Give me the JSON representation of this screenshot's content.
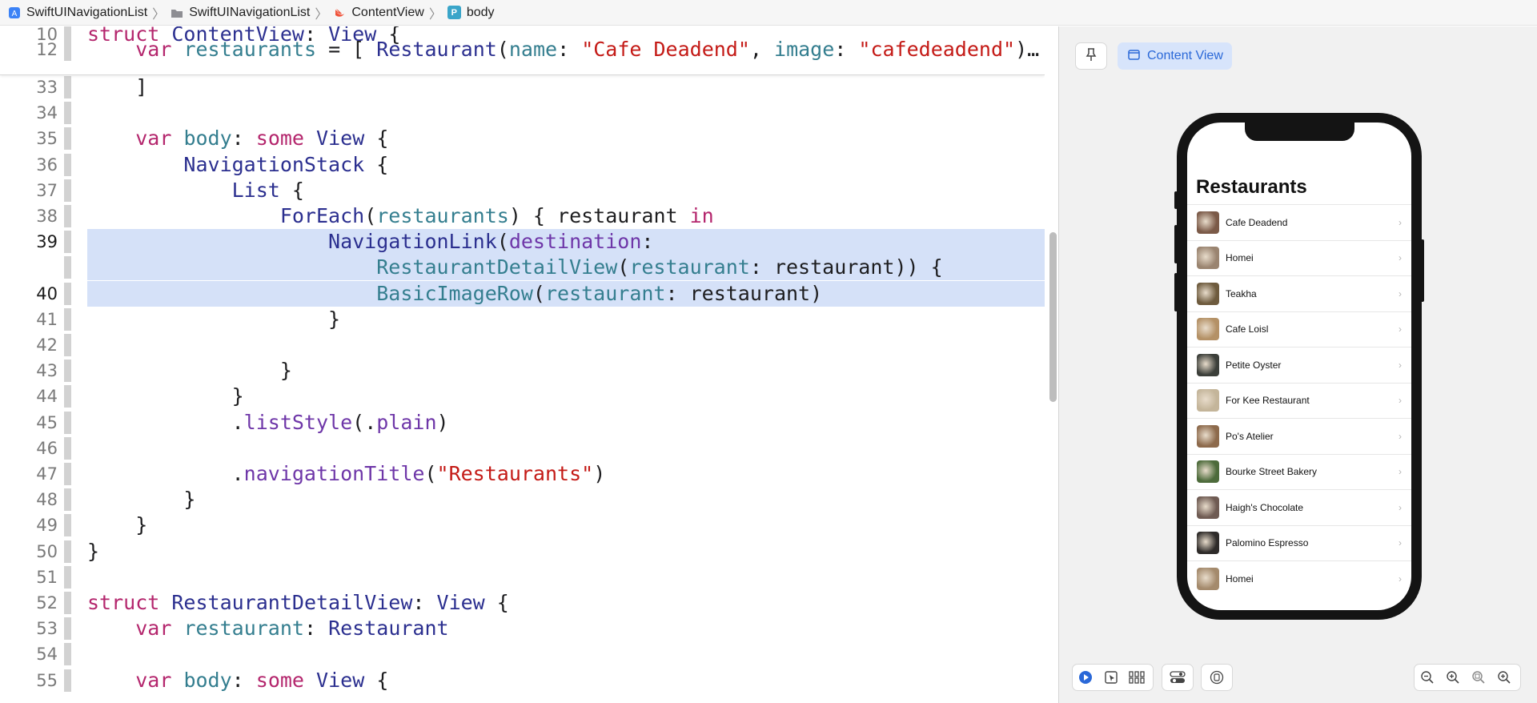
{
  "breadcrumb": {
    "project": "SwiftUINavigationList",
    "folder": "SwiftUINavigationList",
    "file": "ContentView",
    "symbol_badge": "P",
    "symbol": "body"
  },
  "sticky_lines": [
    {
      "number": "10",
      "tokens": [
        {
          "t": "struct",
          "c": "kw"
        },
        {
          "t": " ",
          "c": "tx"
        },
        {
          "t": "ContentView",
          "c": "ty"
        },
        {
          "t": ": ",
          "c": "tx"
        },
        {
          "t": "View",
          "c": "ty"
        },
        {
          "t": " {",
          "c": "tx"
        }
      ]
    },
    {
      "number": "12",
      "tokens": [
        {
          "t": "    ",
          "c": "tx"
        },
        {
          "t": "var",
          "c": "kw"
        },
        {
          "t": " ",
          "c": "tx"
        },
        {
          "t": "restaurants",
          "c": "pr"
        },
        {
          "t": " = [ ",
          "c": "tx"
        },
        {
          "t": "Restaurant",
          "c": "ty"
        },
        {
          "t": "(",
          "c": "tx"
        },
        {
          "t": "name",
          "c": "pr"
        },
        {
          "t": ": ",
          "c": "tx"
        },
        {
          "t": "\"Cafe Deadend\"",
          "c": "st"
        },
        {
          "t": ", ",
          "c": "tx"
        },
        {
          "t": "image",
          "c": "pr"
        },
        {
          "t": ": ",
          "c": "tx"
        },
        {
          "t": "\"cafedeadend\"",
          "c": "st"
        },
        {
          "t": ")…",
          "c": "tx"
        }
      ]
    }
  ],
  "lines": [
    {
      "number": "33",
      "tokens": [
        {
          "t": "    ]",
          "c": "tx"
        }
      ]
    },
    {
      "number": "34",
      "tokens": []
    },
    {
      "number": "35",
      "tokens": [
        {
          "t": "    ",
          "c": "tx"
        },
        {
          "t": "var",
          "c": "kw"
        },
        {
          "t": " ",
          "c": "tx"
        },
        {
          "t": "body",
          "c": "pr"
        },
        {
          "t": ": ",
          "c": "tx"
        },
        {
          "t": "some",
          "c": "kw"
        },
        {
          "t": " ",
          "c": "tx"
        },
        {
          "t": "View",
          "c": "ty"
        },
        {
          "t": " {",
          "c": "tx"
        }
      ]
    },
    {
      "number": "36",
      "tokens": [
        {
          "t": "        ",
          "c": "tx"
        },
        {
          "t": "NavigationStack",
          "c": "ty"
        },
        {
          "t": " {",
          "c": "tx"
        }
      ]
    },
    {
      "number": "37",
      "tokens": [
        {
          "t": "            ",
          "c": "tx"
        },
        {
          "t": "List",
          "c": "ty"
        },
        {
          "t": " {",
          "c": "tx"
        }
      ]
    },
    {
      "number": "38",
      "tokens": [
        {
          "t": "                ",
          "c": "tx"
        },
        {
          "t": "ForEach",
          "c": "ty"
        },
        {
          "t": "(",
          "c": "tx"
        },
        {
          "t": "restaurants",
          "c": "pr"
        },
        {
          "t": ") { restaurant ",
          "c": "tx"
        },
        {
          "t": "in",
          "c": "kw"
        }
      ]
    },
    {
      "number": "39",
      "highlight": true,
      "tokens": [
        {
          "t": "                    ",
          "c": "tx"
        },
        {
          "t": "NavigationLink",
          "c": "ty"
        },
        {
          "t": "(",
          "c": "tx"
        },
        {
          "t": "destination",
          "c": "fn"
        },
        {
          "t": ":",
          "c": "tx"
        }
      ]
    },
    {
      "number": "",
      "highlight": true,
      "tokens": [
        {
          "t": "                        ",
          "c": "tx"
        },
        {
          "t": "RestaurantDetailView",
          "c": "pr"
        },
        {
          "t": "(",
          "c": "tx"
        },
        {
          "t": "restaurant",
          "c": "pr"
        },
        {
          "t": ": restaurant)) {",
          "c": "tx"
        }
      ]
    },
    {
      "number": "40",
      "highlight": true,
      "tokens": [
        {
          "t": "                        ",
          "c": "tx"
        },
        {
          "t": "BasicImageRow",
          "c": "pr"
        },
        {
          "t": "(",
          "c": "tx"
        },
        {
          "t": "restaurant",
          "c": "pr"
        },
        {
          "t": ": restaurant)",
          "c": "tx"
        }
      ]
    },
    {
      "number": "41",
      "tokens": [
        {
          "t": "                    }",
          "c": "tx"
        }
      ]
    },
    {
      "number": "42",
      "tokens": []
    },
    {
      "number": "43",
      "tokens": [
        {
          "t": "                }",
          "c": "tx"
        }
      ]
    },
    {
      "number": "44",
      "tokens": [
        {
          "t": "            }",
          "c": "tx"
        }
      ]
    },
    {
      "number": "45",
      "tokens": [
        {
          "t": "            .",
          "c": "tx"
        },
        {
          "t": "listStyle",
          "c": "fn"
        },
        {
          "t": "(.",
          "c": "tx"
        },
        {
          "t": "plain",
          "c": "fn"
        },
        {
          "t": ")",
          "c": "tx"
        }
      ]
    },
    {
      "number": "46",
      "tokens": []
    },
    {
      "number": "47",
      "tokens": [
        {
          "t": "            .",
          "c": "tx"
        },
        {
          "t": "navigationTitle",
          "c": "fn"
        },
        {
          "t": "(",
          "c": "tx"
        },
        {
          "t": "\"Restaurants\"",
          "c": "st"
        },
        {
          "t": ")",
          "c": "tx"
        }
      ]
    },
    {
      "number": "48",
      "tokens": [
        {
          "t": "        }",
          "c": "tx"
        }
      ]
    },
    {
      "number": "49",
      "tokens": [
        {
          "t": "    }",
          "c": "tx"
        }
      ]
    },
    {
      "number": "50",
      "tokens": [
        {
          "t": "}",
          "c": "tx"
        }
      ]
    },
    {
      "number": "51",
      "tokens": []
    },
    {
      "number": "52",
      "tokens": [
        {
          "t": "struct",
          "c": "kw"
        },
        {
          "t": " ",
          "c": "tx"
        },
        {
          "t": "RestaurantDetailView",
          "c": "ty"
        },
        {
          "t": ": ",
          "c": "tx"
        },
        {
          "t": "View",
          "c": "ty"
        },
        {
          "t": " {",
          "c": "tx"
        }
      ]
    },
    {
      "number": "53",
      "tokens": [
        {
          "t": "    ",
          "c": "tx"
        },
        {
          "t": "var",
          "c": "kw"
        },
        {
          "t": " ",
          "c": "tx"
        },
        {
          "t": "restaurant",
          "c": "pr"
        },
        {
          "t": ": ",
          "c": "tx"
        },
        {
          "t": "Restaurant",
          "c": "ty"
        }
      ]
    },
    {
      "number": "54",
      "tokens": []
    },
    {
      "number": "55",
      "tokens": [
        {
          "t": "    ",
          "c": "tx"
        },
        {
          "t": "var",
          "c": "kw"
        },
        {
          "t": " ",
          "c": "tx"
        },
        {
          "t": "body",
          "c": "pr"
        },
        {
          "t": ": ",
          "c": "tx"
        },
        {
          "t": "some",
          "c": "kw"
        },
        {
          "t": " ",
          "c": "tx"
        },
        {
          "t": "View",
          "c": "ty"
        },
        {
          "t": " {",
          "c": "tx"
        }
      ]
    }
  ],
  "canvas": {
    "pin_icon": "pin-icon",
    "content_view_label": "Content View",
    "preview_title": "Restaurants",
    "restaurants": [
      {
        "name": "Cafe Deadend",
        "thumb": "#7b5a48"
      },
      {
        "name": "Homei",
        "thumb": "#9a8470"
      },
      {
        "name": "Teakha",
        "thumb": "#6e5b3e"
      },
      {
        "name": "Cafe Loisl",
        "thumb": "#b49166"
      },
      {
        "name": "Petite Oyster",
        "thumb": "#3c3f3a"
      },
      {
        "name": "For Kee Restaurant",
        "thumb": "#c4b59a"
      },
      {
        "name": "Po's Atelier",
        "thumb": "#8d6a4c"
      },
      {
        "name": "Bourke Street Bakery",
        "thumb": "#4d6b3b"
      },
      {
        "name": "Haigh's Chocolate",
        "thumb": "#6f5b53"
      },
      {
        "name": "Palomino Espresso",
        "thumb": "#2e2b29"
      },
      {
        "name": "Homei",
        "thumb": "#a48a6c"
      }
    ],
    "bottom_toolbar": [
      "live-preview-icon",
      "selectable-icon",
      "variants-icon",
      "device-settings-icon",
      "device-icon",
      "zoom-out-icon",
      "zoom-100-icon",
      "zoom-fit-icon",
      "zoom-in-icon"
    ]
  },
  "colors": {
    "keyword": "#b4266d",
    "type": "#2b2f8f",
    "string": "#c41a16",
    "property": "#347e8f",
    "function": "#6e36a8",
    "highlight": "#d5e1f8",
    "accent": "#2a68d8"
  }
}
